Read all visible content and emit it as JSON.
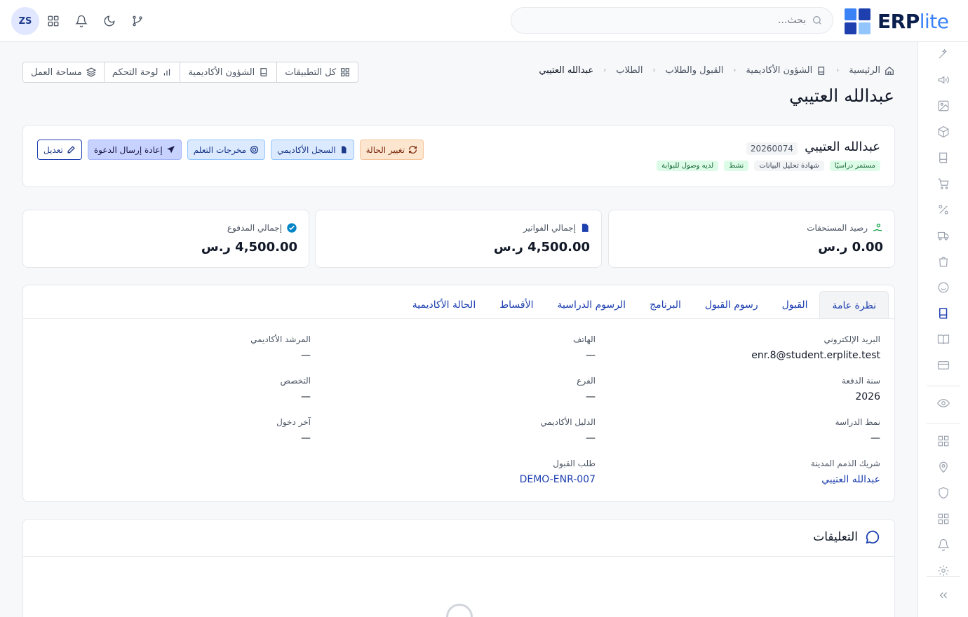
{
  "app": {
    "brand_main": "ERP",
    "brand_suffix": "lite",
    "avatar_initials": "ZS"
  },
  "search": {
    "placeholder": "بحث..."
  },
  "breadcrumb": [
    "الرئيسية",
    "الشؤون الأكاديمية",
    "القبول والطلاب",
    "الطلاب",
    "عبدالله العتيبي"
  ],
  "quick_links": [
    "كل التطبيقات",
    "الشؤون الأكاديمية",
    "لوحة التحكم",
    "مساحة العمل"
  ],
  "page_title": "عبدالله العتيبي",
  "student": {
    "name": "عبدالله العتيبي",
    "id": "20260074",
    "badges": [
      "مستمر دراسيًا",
      "شهادة تحليل البيانات",
      "نشط",
      "لديه وصول للبوابة"
    ]
  },
  "actions": [
    "تغيير الحالة",
    "السجل الأكاديمي",
    "مخرجات التعلم",
    "إعادة إرسال الدعوة",
    "تعديل"
  ],
  "stats": [
    {
      "label": "رصيد المستحقات",
      "value": "0.00 ر.س"
    },
    {
      "label": "إجمالي الفواتير",
      "value": "4,500.00 ر.س"
    },
    {
      "label": "إجمالي المدفوع",
      "value": "4,500.00 ر.س"
    }
  ],
  "tabs": [
    "نظرة عامة",
    "القبول",
    "رسوم القبول",
    "البرنامج",
    "الرسوم الدراسية",
    "الأقساط",
    "الحالة الأكاديمية"
  ],
  "fields": [
    {
      "label": "البريد الإلكتروني",
      "value": "enr.8@student.erplite.test"
    },
    {
      "label": "الهاتف",
      "value": "—"
    },
    {
      "label": "المرشد الأكاديمي",
      "value": "—"
    },
    {
      "label": "سنة الدفعة",
      "value": "2026"
    },
    {
      "label": "الفرع",
      "value": "—"
    },
    {
      "label": "التخصص",
      "value": "—"
    },
    {
      "label": "نمط الدراسة",
      "value": "—"
    },
    {
      "label": "الدليل الأكاديمي",
      "value": "—"
    },
    {
      "label": "آخر دخول",
      "value": "—"
    },
    {
      "label": "شريك الذمم المدينة",
      "value": "عبدالله العتيبي"
    },
    {
      "label": "طلب القبول",
      "value": "DEMO-ENR-007"
    }
  ],
  "comments": {
    "title": "التعليقات"
  },
  "colors": {
    "primary": "#1e40af",
    "brand_dark": "#0b1f4d",
    "brand_light": "#3b82f6",
    "success": "#16a34a",
    "border": "#e5e7eb"
  }
}
